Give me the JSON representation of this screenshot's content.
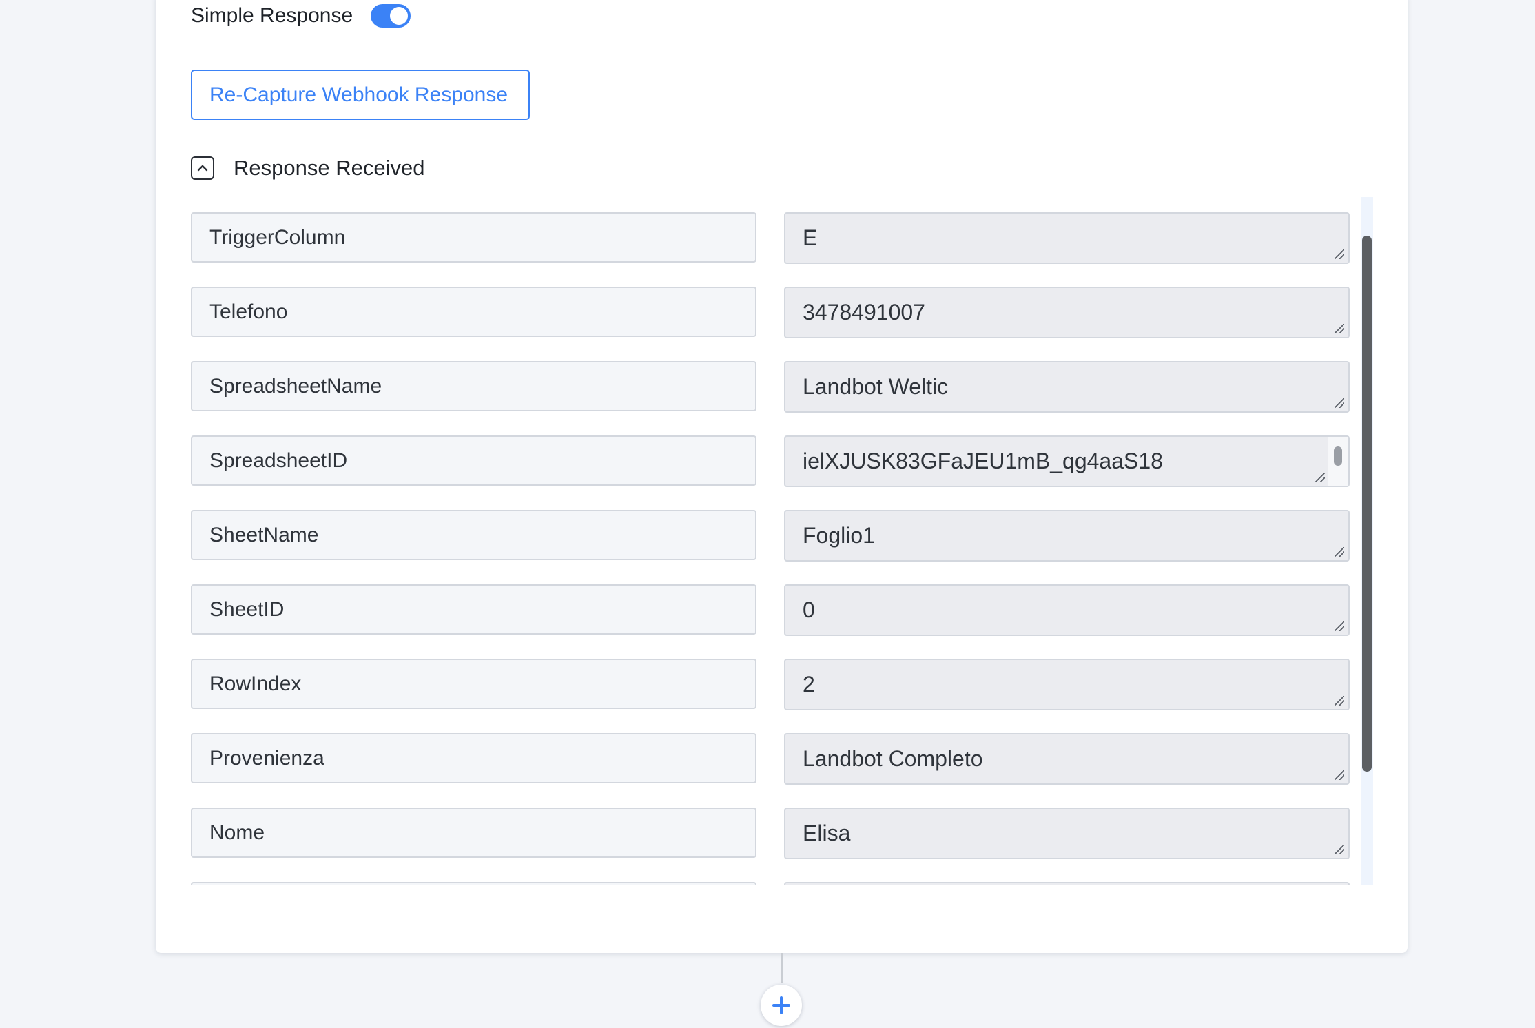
{
  "simple_response": {
    "label": "Simple Response",
    "enabled": true
  },
  "recapture_button": {
    "label": "Re-Capture Webhook Response"
  },
  "response_section": {
    "title": "Response Received",
    "expanded": true,
    "fields": [
      {
        "key": "TriggerColumn",
        "value": "E"
      },
      {
        "key": "Telefono",
        "value": "3478491007"
      },
      {
        "key": "SpreadsheetName",
        "value": "Landbot Weltic"
      },
      {
        "key": "SpreadsheetID",
        "value": "ielXJUSK83GFaJEU1mB_qg4aaS18"
      },
      {
        "key": "SheetName",
        "value": "Foglio1"
      },
      {
        "key": "SheetID",
        "value": "0"
      },
      {
        "key": "RowIndex",
        "value": "2"
      },
      {
        "key": "Provenienza",
        "value": "Landbot Completo"
      },
      {
        "key": "Nome",
        "value": "Elisa"
      }
    ]
  },
  "colors": {
    "accent": "#3b82f6",
    "page_background": "#f3f5f9",
    "card_background": "#ffffff"
  },
  "icons": {
    "collapse": "chevron-up-icon",
    "add_step": "plus-icon"
  }
}
